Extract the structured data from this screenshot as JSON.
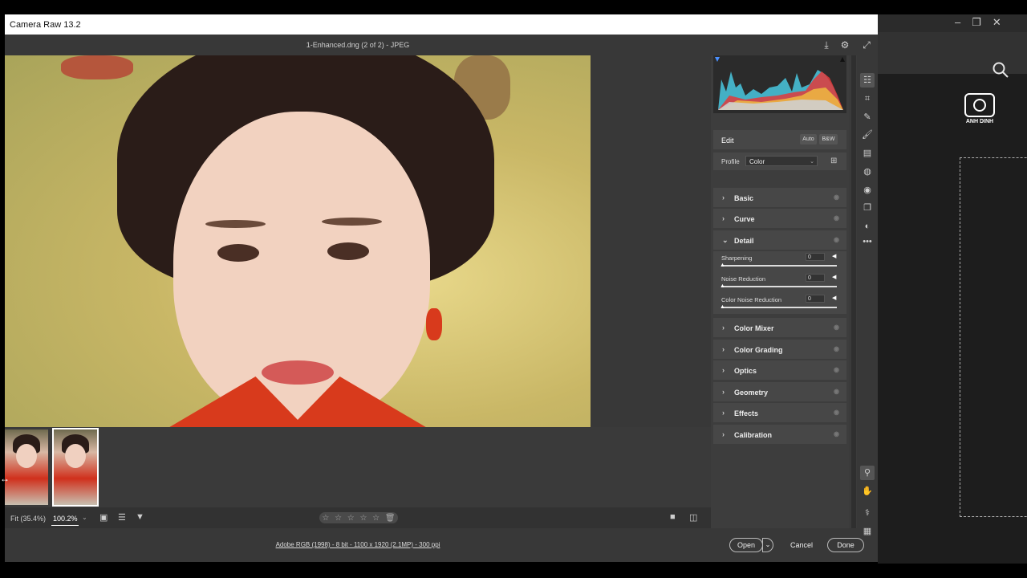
{
  "dialog": {
    "title": "Camera Raw 13.2",
    "file_title": "1-Enhanced.dng (2 of 2)  -  JPEG"
  },
  "background_app": {
    "logo_text": "ANH DINH",
    "window_controls": [
      "–",
      "❐",
      "✕"
    ],
    "icons": [
      "search-icon",
      "camera-logo-icon"
    ]
  },
  "header_icons": [
    "save-icon",
    "gear-icon",
    "fullscreen-icon"
  ],
  "bottom_bar": {
    "fit_label": "Fit (35.4%)",
    "zoom_label": "100.2%",
    "rating_stars": [
      "☆",
      "☆",
      "☆",
      "☆",
      "☆"
    ],
    "icons": [
      "compare-icon",
      "sort-icon",
      "filter-icon",
      "single-view-icon",
      "before-after-icon"
    ]
  },
  "footer": {
    "image_info": "Adobe RGB (1998) - 8 bit - 1100 x 1920 (2.1MP) - 300 ppi",
    "open_label": "Open",
    "cancel_label": "Cancel",
    "done_label": "Done"
  },
  "panel": {
    "edit_title": "Edit",
    "auto_label": "Auto",
    "bw_label": "B&W",
    "profile_label": "Profile",
    "profile_value": "Color",
    "sections": {
      "basic": "Basic",
      "curve": "Curve",
      "detail": "Detail",
      "color_mixer": "Color Mixer",
      "color_grading": "Color Grading",
      "optics": "Optics",
      "geometry": "Geometry",
      "effects": "Effects",
      "calibration": "Calibration"
    },
    "detail": {
      "sharpening_label": "Sharpening",
      "sharpening_value": "0",
      "noise_label": "Noise Reduction",
      "noise_value": "0",
      "color_noise_label": "Color Noise Reduction",
      "color_noise_value": "0"
    }
  },
  "tools": [
    "edit-icon",
    "crop-icon",
    "healing-icon",
    "brush-icon",
    "gradient-icon",
    "radial-icon",
    "redeye-icon",
    "snapshots-icon",
    "presets-icon",
    "more-icon",
    "zoom-icon",
    "hand-icon",
    "color-sampler-icon",
    "grid-icon"
  ],
  "colors": {
    "dialog_bg": "#3b3b3b",
    "panel_bg": "#474747",
    "accent_white": "#ffffff"
  }
}
